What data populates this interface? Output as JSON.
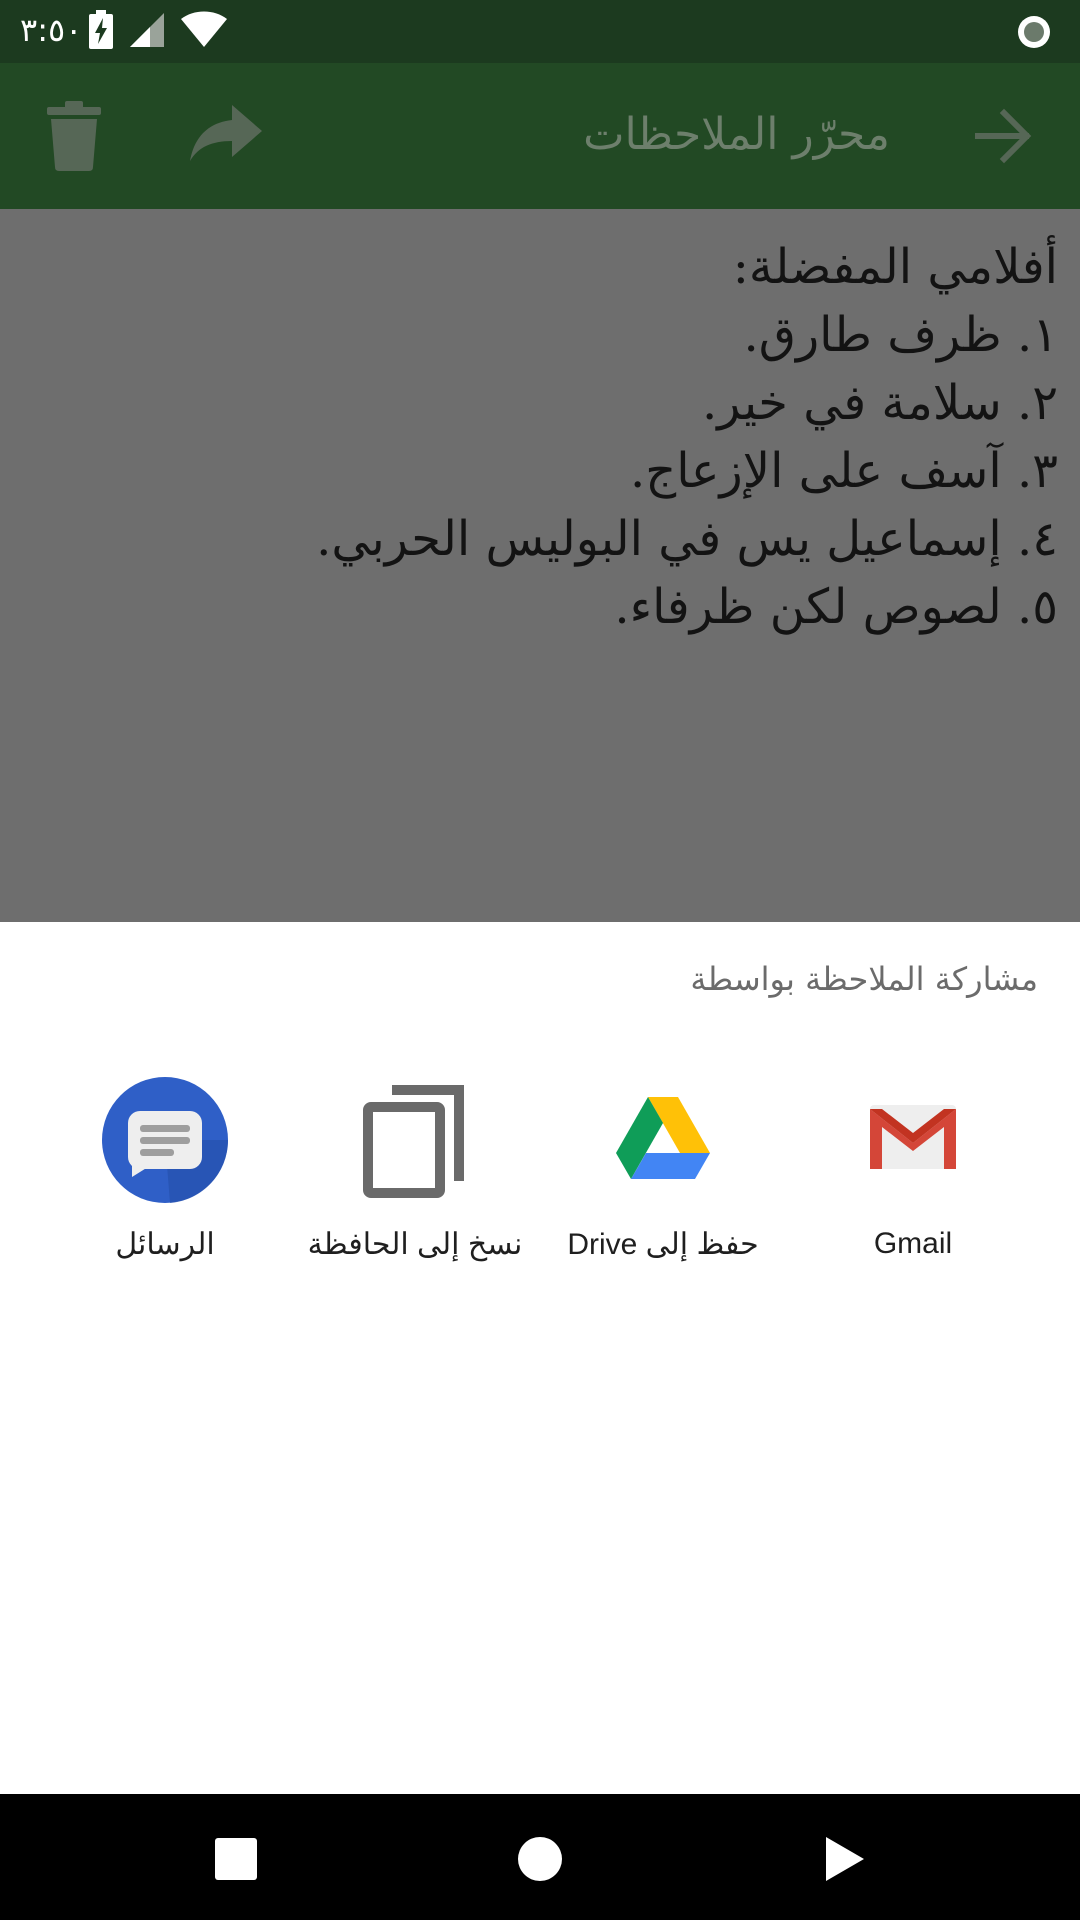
{
  "status_bar": {
    "time": "٣:٥٠",
    "icons": [
      "battery-charging-icon",
      "signal-icon",
      "wifi-icon",
      "record-icon"
    ]
  },
  "toolbar": {
    "title": "محرّر الملاحظات",
    "icons": [
      "delete-icon",
      "share-icon",
      "back-arrow-icon"
    ]
  },
  "note": {
    "lines": [
      "أفلامي المفضلة:",
      "١. ظرف طارق.",
      "٢. سلامة في خير.",
      "٣. آسف على الإزعاج.",
      "٤. إسماعيل يس في البوليس الحربي.",
      "٥. لصوص لكن ظرفاء."
    ]
  },
  "share_sheet": {
    "title": "مشاركة الملاحظة بواسطة",
    "targets": [
      {
        "label": "Gmail",
        "icon": "gmail-icon"
      },
      {
        "label": "حفظ إلى Drive",
        "icon": "drive-icon"
      },
      {
        "label": "نسخ إلى الحافظة",
        "icon": "copy-icon"
      },
      {
        "label": "الرسائل",
        "icon": "messages-icon"
      }
    ]
  },
  "nav_bar": {
    "icons": [
      "recents-icon",
      "home-icon",
      "back-icon"
    ]
  },
  "colors": {
    "status_bar_bg": "#1c3a1f",
    "toolbar_bg": "#224924",
    "scrim": "#6e6e6e",
    "gmail_red": "#d44638",
    "messages_blue": "#2f5fc7"
  }
}
